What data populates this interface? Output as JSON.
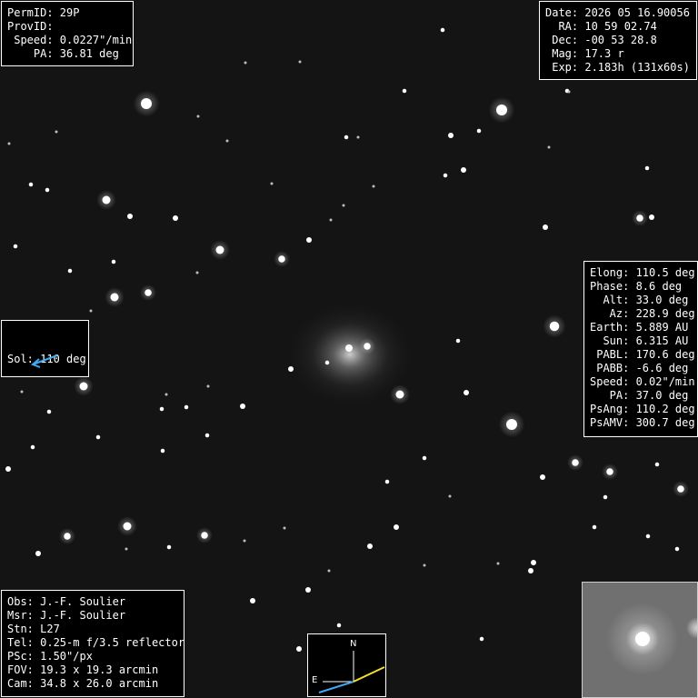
{
  "top_left": {
    "lines": [
      "PermID: 29P",
      "ProvID:",
      " Speed: 0.0227\"/min",
      "    PA: 36.81 deg"
    ]
  },
  "top_right": {
    "lines": [
      "Date: 2026 05 16.90056",
      "  RA: 10 59 02.74",
      " Dec: -00 53 28.8",
      " Mag: 17.3 r",
      " Exp: 2.183h (131x60s)"
    ]
  },
  "mid_right": {
    "lines": [
      "Elong: 110.5 deg",
      "Phase: 8.6 deg",
      "  Alt: 33.0 deg",
      "   Az: 228.9 deg",
      "Earth: 5.889 AU",
      "  Sun: 6.315 AU",
      " PABL: 170.6 deg",
      " PABB: -6.6 deg",
      "Speed: 0.02\"/min",
      "   PA: 37.0 deg",
      "PsAng: 110.2 deg",
      "PsAMV: 300.7 deg"
    ]
  },
  "mid_left": {
    "lines": [
      "Sol: 110 deg"
    ],
    "arrow_color": "#3fa9f5"
  },
  "bottom_left": {
    "lines": [
      "Obs: J.-F. Soulier",
      "Msr: J.-F. Soulier",
      "Stn: L27",
      "Tel: 0.25-m f/3.5 reflector",
      "PSc: 1.50\"/px",
      "FOV: 19.3 x 19.3 arcmin",
      "Cam: 34.8 x 26.0 arcmin"
    ]
  },
  "compass": {
    "north_label": "N",
    "east_label": "E",
    "motion_color": "#f5e02a",
    "sun_color": "#3fa9f5"
  }
}
